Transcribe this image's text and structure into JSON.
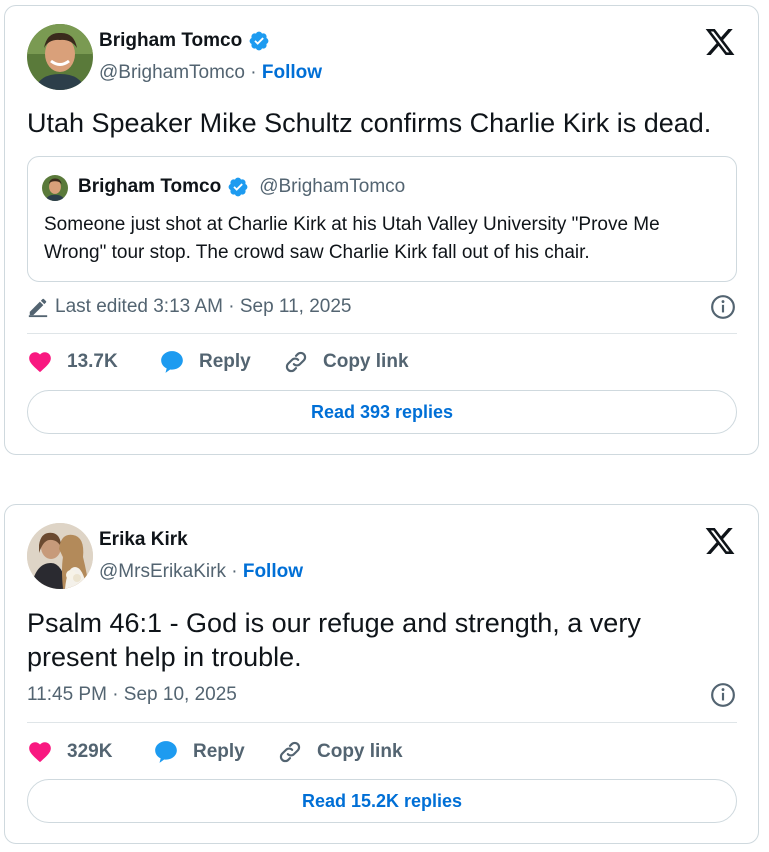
{
  "tweets": [
    {
      "author": {
        "name": "Brigham Tomco",
        "handle": "@BrighamTomco",
        "verified": true
      },
      "follow_label": "Follow",
      "separator": "·",
      "text": "Utah Speaker Mike Schultz confirms Charlie Kirk is dead.",
      "quote": {
        "author": {
          "name": "Brigham Tomco",
          "handle": "@BrighamTomco"
        },
        "text": "Someone just shot at Charlie Kirk at his Utah Valley University \"Prove Me Wrong\" tour stop. The crowd saw Charlie Kirk fall out of his chair."
      },
      "timestamp": "Last edited 3:13 AM · Sep 11, 2025",
      "likes": "13.7K",
      "reply_label": "Reply",
      "copy_label": "Copy link",
      "read_replies": "Read 393 replies"
    },
    {
      "author": {
        "name": "Erika Kirk",
        "handle": "@MrsErikaKirk",
        "verified": false
      },
      "follow_label": "Follow",
      "separator": "·",
      "text": "Psalm 46:1 - God is our refuge and strength, a very present help in trouble.",
      "timestamp": "11:45 PM · Sep 10, 2025",
      "likes": "329K",
      "reply_label": "Reply",
      "copy_label": "Copy link",
      "read_replies": "Read 15.2K replies"
    }
  ],
  "colors": {
    "accent": "#006fd6",
    "like": "#f91880",
    "reply": "#1d9bf0",
    "verified": "#1d9bf0",
    "muted": "#536471",
    "border": "#cfd9de"
  },
  "icons": [
    "verified-badge-icon",
    "x-logo-icon",
    "edit-pencil-icon",
    "info-icon",
    "heart-icon",
    "reply-bubble-icon",
    "link-icon"
  ]
}
